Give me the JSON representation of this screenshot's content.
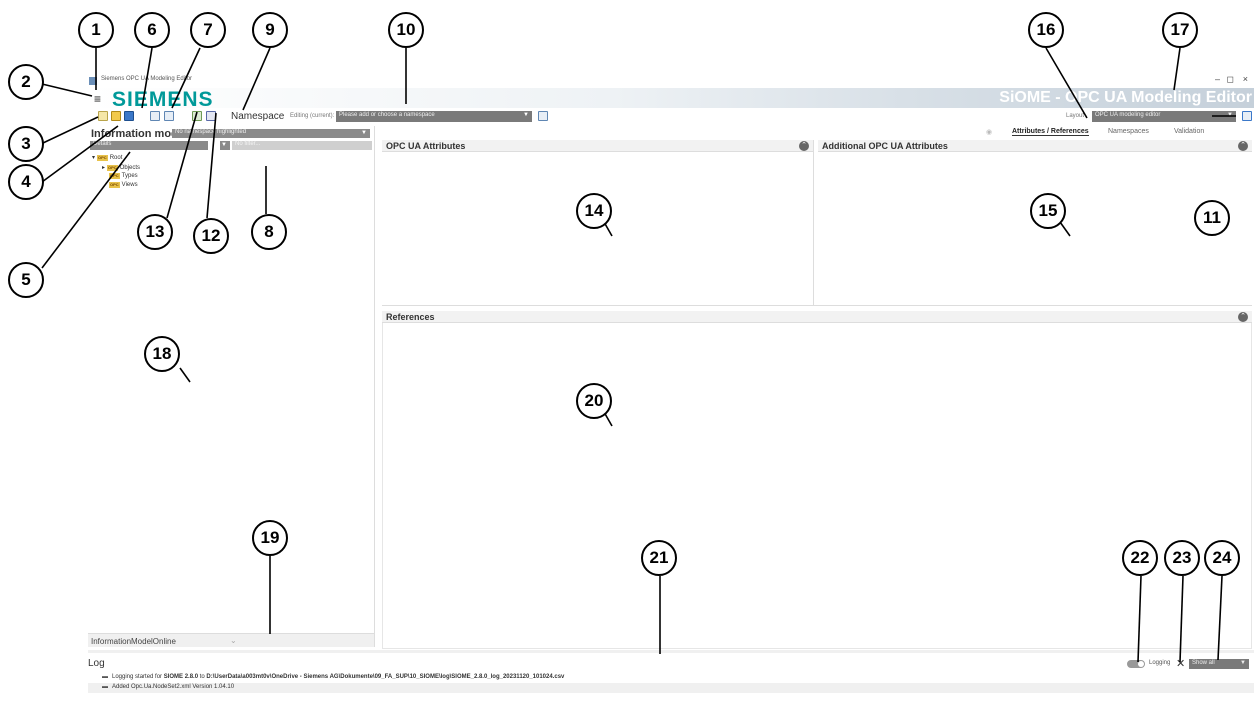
{
  "window": {
    "title": "Siemens OPC UA Modeling Editor",
    "controls": {
      "minimize": "–",
      "maximize": "◻",
      "close": "×"
    }
  },
  "header": {
    "menu_icon": "hamburger-icon",
    "logo": "SIEMENS",
    "app_title": "SiOME - OPC UA Modeling Editor",
    "brand_color": "#009999"
  },
  "toolbar": {
    "namespace_label": "Namespace",
    "editing_label": "Editing (current):",
    "namespace_placeholder": "Please add or choose a namespace",
    "layout_label": "Layout",
    "layout_value": "OPC UA modeling editor"
  },
  "left_panel": {
    "title": "Information model",
    "filter_dropdown": "No namespace highlighted",
    "details_label": "Details",
    "search_placeholder": "No filter...",
    "tree": {
      "root": "Root",
      "children": [
        "Objects",
        "Types",
        "Views"
      ],
      "badge": "OPC"
    },
    "online_label": "InformationModelOnline"
  },
  "tabs": {
    "items": [
      "Attributes / References",
      "Namespaces",
      "Validation"
    ],
    "active": "Attributes / References"
  },
  "panels": {
    "opc_attributes": "OPC UA Attributes",
    "additional_attributes": "Additional OPC UA Attributes",
    "references": "References"
  },
  "log": {
    "title": "Log",
    "line1_prefix": "Logging started for ",
    "line1_bold": "SIOME 2.8.0",
    "line1_mid": " to ",
    "line1_path": "D:\\UserData\\a003mt0v\\OneDrive - Siemens AG\\Dokumente\\09_FA_SUP\\10_SIOME\\log\\SIOME_2.8.0_log_20231120_101024.csv",
    "line2": "Added Opc.Ua.NodeSet2.xml Version 1.04.10",
    "logging_toggle_label": "Logging",
    "filter_value": "Show all"
  },
  "callouts": [
    "1",
    "2",
    "3",
    "4",
    "5",
    "6",
    "7",
    "8",
    "9",
    "10",
    "11",
    "12",
    "13",
    "14",
    "15",
    "16",
    "17",
    "18",
    "19",
    "20",
    "21",
    "22",
    "23",
    "24"
  ]
}
